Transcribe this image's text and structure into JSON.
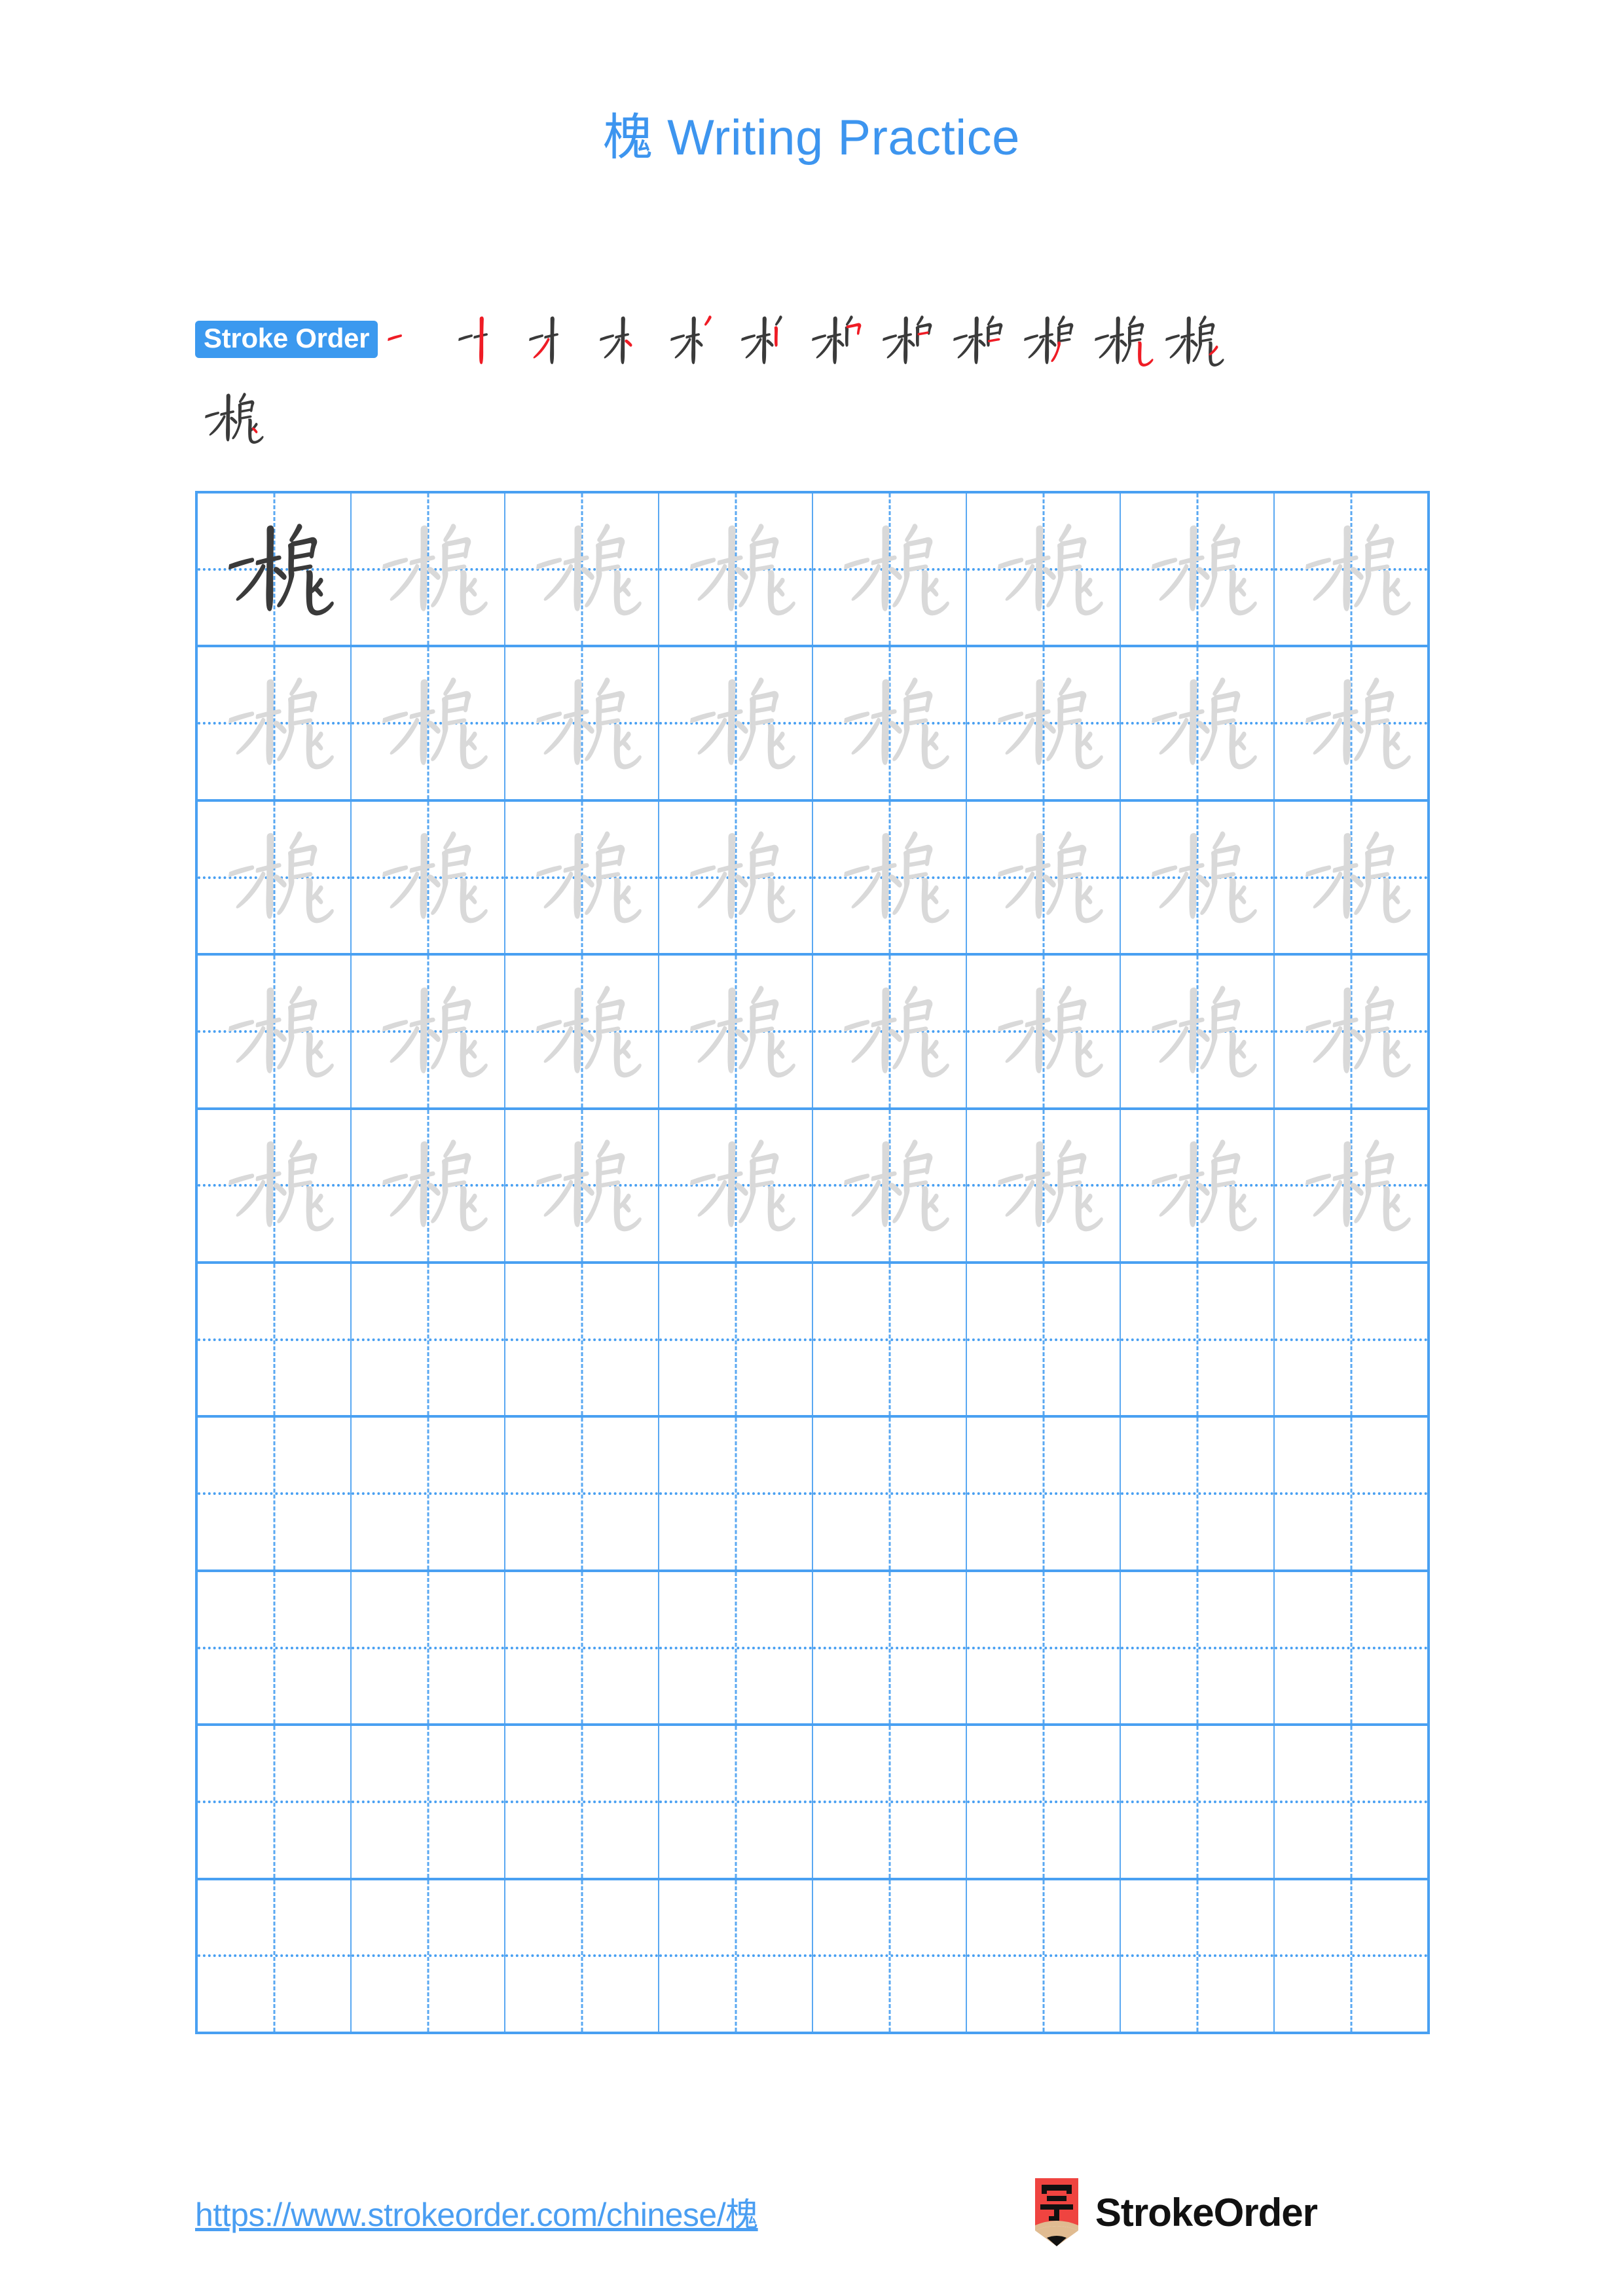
{
  "page": {
    "character": "槐",
    "background_color": "#ffffff"
  },
  "header": {
    "title": "槐 Writing Practice",
    "title_character": "槐",
    "title_suffix": " Writing Practice",
    "title_color": "#3d95ef"
  },
  "stroke_order": {
    "badge_label": "Stroke Order",
    "badge_bg_color": "#3b99ef",
    "badge_text_color": "#ffffff",
    "total_strokes": 13,
    "previous_stroke_color": "#3a3a3a",
    "new_stroke_color": "#ef1c25",
    "steps": [
      {
        "index": 1,
        "strokes_shown": 1,
        "new_stroke": "héng (一)"
      },
      {
        "index": 2,
        "strokes_shown": 2,
        "new_stroke": "shù (丨)"
      },
      {
        "index": 3,
        "strokes_shown": 3,
        "new_stroke": "piě (丿)"
      },
      {
        "index": 4,
        "strokes_shown": 4,
        "new_stroke": "diǎn (丶)"
      },
      {
        "index": 5,
        "strokes_shown": 5,
        "new_stroke": "piě (丿)"
      },
      {
        "index": 6,
        "strokes_shown": 6,
        "new_stroke": "shù (丨)"
      },
      {
        "index": 7,
        "strokes_shown": 7,
        "new_stroke": "héngzhé (𠃍)"
      },
      {
        "index": 8,
        "strokes_shown": 8,
        "new_stroke": "héng (一)"
      },
      {
        "index": 9,
        "strokes_shown": 9,
        "new_stroke": "héng (一)"
      },
      {
        "index": 10,
        "strokes_shown": 10,
        "new_stroke": "piě (丿)"
      },
      {
        "index": 11,
        "strokes_shown": 11,
        "new_stroke": "shùwān­gōu (乚)"
      },
      {
        "index": 12,
        "strokes_shown": 12,
        "new_stroke": "sī (厶) piě"
      },
      {
        "index": 13,
        "strokes_shown": 13,
        "new_stroke": "sī (厶) diǎn"
      }
    ]
  },
  "practice_grid": {
    "columns": 8,
    "rows": 10,
    "grid_line_color": "#49a0f2",
    "guide_line_color": "#5aa8f2",
    "model_char_color": "#3a3a3a",
    "trace_char_color": "#d9d9d9",
    "cells": [
      [
        "model",
        "trace",
        "trace",
        "trace",
        "trace",
        "trace",
        "trace",
        "trace"
      ],
      [
        "trace",
        "trace",
        "trace",
        "trace",
        "trace",
        "trace",
        "trace",
        "trace"
      ],
      [
        "trace",
        "trace",
        "trace",
        "trace",
        "trace",
        "trace",
        "trace",
        "trace"
      ],
      [
        "trace",
        "trace",
        "trace",
        "trace",
        "trace",
        "trace",
        "trace",
        "trace"
      ],
      [
        "trace",
        "trace",
        "trace",
        "trace",
        "trace",
        "trace",
        "trace",
        "trace"
      ],
      [
        "empty",
        "empty",
        "empty",
        "empty",
        "empty",
        "empty",
        "empty",
        "empty"
      ],
      [
        "empty",
        "empty",
        "empty",
        "empty",
        "empty",
        "empty",
        "empty",
        "empty"
      ],
      [
        "empty",
        "empty",
        "empty",
        "empty",
        "empty",
        "empty",
        "empty",
        "empty"
      ],
      [
        "empty",
        "empty",
        "empty",
        "empty",
        "empty",
        "empty",
        "empty",
        "empty"
      ],
      [
        "empty",
        "empty",
        "empty",
        "empty",
        "empty",
        "empty",
        "empty",
        "empty"
      ]
    ]
  },
  "footer": {
    "url": "https://www.strokeorder.com/chinese/槐",
    "url_color": "#4a9ef2",
    "logo_text": "StrokeOrder",
    "logo_glyph": "字",
    "logo_body_color": "#ef4440",
    "logo_wood_color": "#e0bb91",
    "logo_tip_color": "#111111"
  }
}
